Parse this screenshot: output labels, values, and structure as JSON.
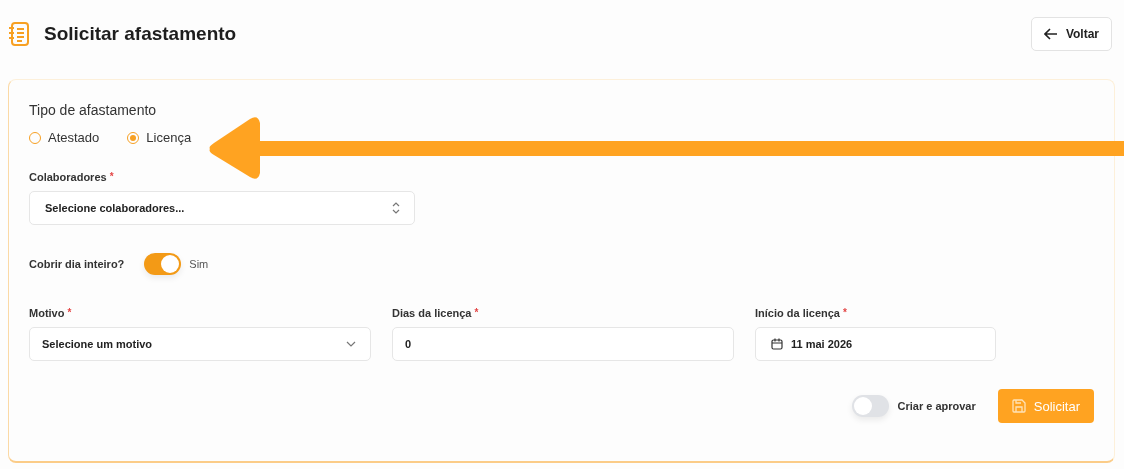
{
  "header": {
    "title": "Solicitar afastamento",
    "back_button": "Voltar"
  },
  "form": {
    "type_group": {
      "label": "Tipo de afastamento",
      "options": [
        {
          "label": "Atestado",
          "selected": false
        },
        {
          "label": "Licença",
          "selected": true
        }
      ]
    },
    "collaborators": {
      "label": "Colaboradores",
      "required_mark": "*",
      "placeholder": "Selecione colaboradores..."
    },
    "full_day": {
      "label": "Cobrir dia inteiro?",
      "on": true,
      "state_label": "Sim"
    },
    "fields": [
      {
        "kind": "select",
        "label": "Motivo",
        "required_mark": "*",
        "placeholder": "Selecione um motivo"
      },
      {
        "kind": "number",
        "label": "Dias da licença",
        "required_mark": "*",
        "value": "0"
      },
      {
        "kind": "date",
        "label": "Início da licença",
        "required_mark": "*",
        "value": "11 mai 2026"
      }
    ],
    "create_and_approve": {
      "label": "Criar e aprovar",
      "on": false
    },
    "submit_button": "Solicitar"
  },
  "annotation": {
    "kind": "arrow"
  }
}
